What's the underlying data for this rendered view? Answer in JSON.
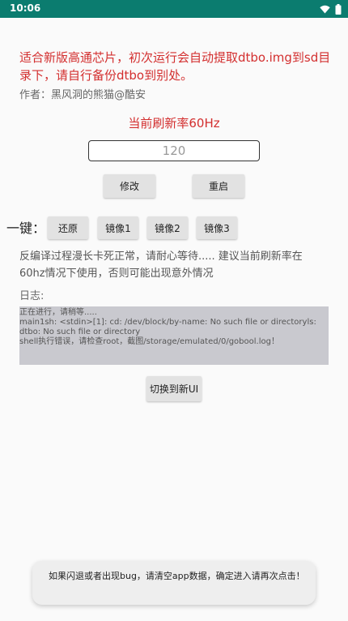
{
  "status_bar": {
    "time": "10:06",
    "wifi_icon": "wifi-icon",
    "battery_icon": "battery-icon"
  },
  "warning_text": "适合新版高通芯片，初次运行会自动提取dtbo.img到sd目录下，请自行备份dtbo到别处。",
  "author_text": "作者：黑风洞的熊猫@酷安",
  "current_rate_text": "当前刷新率60Hz",
  "rate_input": {
    "value": "120"
  },
  "buttons": {
    "modify": "修改",
    "reboot": "重启",
    "switch_ui": "切换到新UI"
  },
  "one_key": {
    "label": "一键：",
    "restore": "还原",
    "mirror1": "镜像1",
    "mirror2": "镜像2",
    "mirror3": "镜像3"
  },
  "note_text": "反编译过程漫长卡死正常，请耐心等待..... 建议当前刷新率在60hz情况下使用，否则可能出现意外情况",
  "log": {
    "label": "日志:",
    "lines": [
      "正在进行，请稍等.....",
      "main1sh: <stdin>[1]: cd: /dev/block/by-name: No such file or directoryls: dtbo: No such file or directory",
      "shell执行错误，请检查root，截图/storage/emulated/0/gobool.log！"
    ]
  },
  "toast_text": "如果闪退或者出现bug，请清空app数据，确定进入请再次点击！"
}
